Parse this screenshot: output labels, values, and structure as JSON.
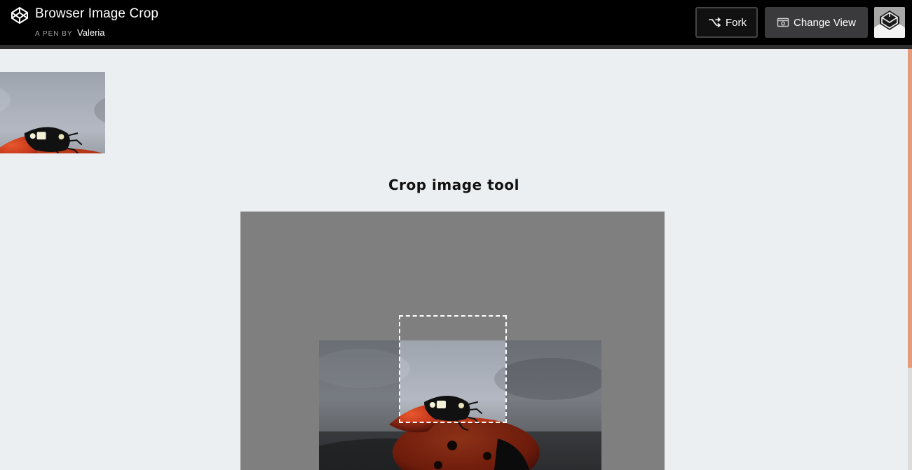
{
  "header": {
    "title": "Browser Image Crop",
    "byline_label": "A PEN BY",
    "author": "Valeria",
    "fork_label": "Fork",
    "change_view_label": "Change View",
    "logo_icon": "codepen-logo-icon",
    "avatar_icon": "user-avatar"
  },
  "page": {
    "heading": "Crop image tool"
  },
  "colors": {
    "header_bg": "#000000",
    "page_bg": "#eceff1",
    "stage_bg": "#7f7f7f",
    "scrollbar_accent": "#e39b7b",
    "crop_border": "#ffffff"
  }
}
